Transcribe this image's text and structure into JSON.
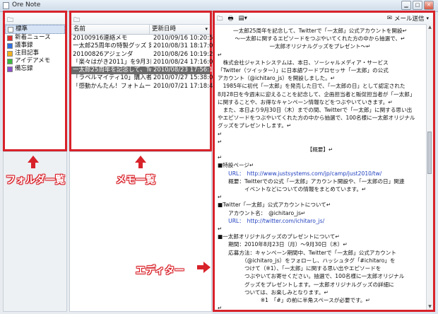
{
  "window": {
    "title": "Ore Note"
  },
  "folders": {
    "items": [
      {
        "label": "標準",
        "color": "#ffffff",
        "selected": true
      },
      {
        "label": "新着ニュース",
        "color": "#e0302f",
        "selected": false
      },
      {
        "label": "議事録",
        "color": "#2f6fe0",
        "selected": false
      },
      {
        "label": "注目記事",
        "color": "#f0b020",
        "selected": false
      },
      {
        "label": "アイデアメモ",
        "color": "#3db83d",
        "selected": false
      },
      {
        "label": "備忘録",
        "color": "#8a4fc8",
        "selected": false
      }
    ]
  },
  "memos": {
    "col_name": "名前",
    "col_date": "更新日時",
    "rows": [
      {
        "name": "20100916連絡メモ",
        "date": "2010/09/16 10:20:56",
        "selected": false
      },
      {
        "name": "一太郎25周年の特製グッズ 第2弾",
        "date": "2010/08/31 18:17:02",
        "selected": false
      },
      {
        "name": "20100826アジェンダ",
        "date": "2010/08/26 10:19:20",
        "selected": false
      },
      {
        "name": "「楽々はがき2011」を9月3日(金...",
        "date": "2010/08/24 17:16:02",
        "selected": false
      },
      {
        "name": "一太郎25周年を記念して、Twitt...",
        "date": "2010/08/23 17:56:16",
        "selected": true
      },
      {
        "name": "「ラベルマイティ10」購入者に",
        "date": "2010/07/27 15:38:02",
        "selected": false
      },
      {
        "name": "「感動かんたん！フォトムービー...",
        "date": "2010/07/21 17:18:42",
        "selected": false
      }
    ]
  },
  "editor": {
    "mail_label": "メール送信",
    "lines": [
      {
        "text": "一太郎25周年を記念して、Twitterで「一太郎」公式アカウントを開設↵",
        "cls": "center"
      },
      {
        "text": "～一太郎に関するエピソードをつぶやいてくれた方の中から抽選で、↵",
        "cls": "center"
      },
      {
        "text": "一太郎オリジナルグッズをプレゼント～↵",
        "cls": "center"
      },
      {
        "text": "↵",
        "cls": ""
      },
      {
        "text": "　株式会社ジャストシステムは、本日、ソーシャルメディア・サービス",
        "cls": ""
      },
      {
        "text": "「Twitter（ツイッター）」に日本語ワードプロセッサ「一太郎」の公式",
        "cls": ""
      },
      {
        "text": "アカウント（@ichitaro_js）を開設しました。↵",
        "cls": ""
      },
      {
        "text": "　1985年に初代「一太郎」を発売した日で、「一太郎の日」として認定された",
        "cls": ""
      },
      {
        "text": "8月28日を今週末に迎えることを記念して、企画担当者と販促担当者が「一太郎」",
        "cls": ""
      },
      {
        "text": "に関することや、お得なキャンペーン情報などをつぶやいていきます。↵",
        "cls": ""
      },
      {
        "text": "　また、本日より9月30日（木）までの間、Twitterで「一太郎」に関する思い出",
        "cls": ""
      },
      {
        "text": "やエピソードをつぶやいてくれた方の中から抽選で、100名様に一太郎オリジナル",
        "cls": ""
      },
      {
        "text": "グッズをプレゼントします。↵",
        "cls": ""
      },
      {
        "text": "↵",
        "cls": ""
      },
      {
        "text": "↵",
        "cls": ""
      },
      {
        "text": "【概要】↵",
        "cls": "center"
      },
      {
        "text": "↵",
        "cls": ""
      },
      {
        "text": "■特設ページ↵",
        "cls": ""
      },
      {
        "text": "　　URL：　http://www.justsystems.com/jp/camp/just2010/tw/",
        "cls": "link1"
      },
      {
        "text": "　　概要：Twitterでの公式「一太郎」アカウント開設や、「一太郎の日」関連",
        "cls": ""
      },
      {
        "text": "　　　　　イベントなどについての情報をまとめています。↵",
        "cls": ""
      },
      {
        "text": "↵",
        "cls": ""
      },
      {
        "text": "■Twitter「一太郎」公式アカウントについて↵",
        "cls": ""
      },
      {
        "text": "　　アカウント名：　@ichitaro_js↵",
        "cls": ""
      },
      {
        "text": "　　URL：　http://twitter.com/ichitaro_js/",
        "cls": "link2"
      },
      {
        "text": "↵",
        "cls": ""
      },
      {
        "text": "■一太郎オリジナルグッズのプレゼントについて↵",
        "cls": ""
      },
      {
        "text": "　　期間：2010年8月23日（月）～9月30日（木）↵",
        "cls": ""
      },
      {
        "text": "　　応募方法：キャンペーン期間中、Twitterで「一太郎」公式アカウント",
        "cls": ""
      },
      {
        "text": "　　　　　（@ichitaro_js）をフォローし、ハッシュタグ「#ichitaro」を",
        "cls": ""
      },
      {
        "text": "　　　　　つけて（※1）、「一太郎」に関する思い出やエピソードを",
        "cls": ""
      },
      {
        "text": "　　　　　つぶやいてお寄せください。抽選で、100名様に一太郎オリジナル",
        "cls": ""
      },
      {
        "text": "　　　　　グッズをプレゼントします。一太郎オリジナルグッズの詳細に",
        "cls": ""
      },
      {
        "text": "　　　　　ついては、お楽しみとなります。↵",
        "cls": ""
      },
      {
        "text": "　　　　　　　　※1　「#」の前に半角スペースが必要です。↵",
        "cls": ""
      },
      {
        "text": "↵",
        "cls": ""
      }
    ]
  },
  "annotations": {
    "folder_label": "フォルダ一覧",
    "memo_label": "メモ一覧",
    "editor_label": "エディター"
  }
}
